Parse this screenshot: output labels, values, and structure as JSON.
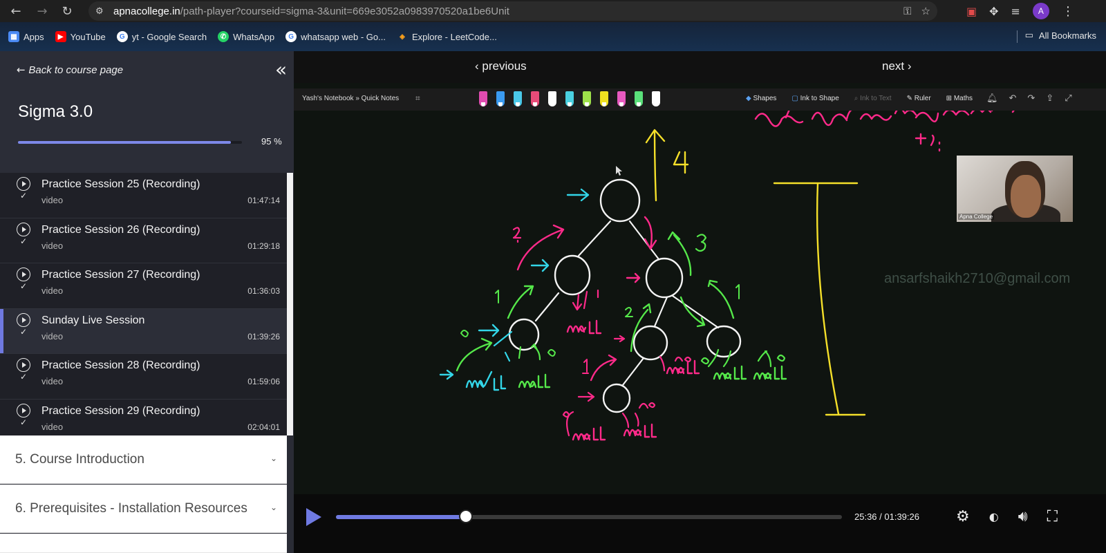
{
  "browser": {
    "url_domain": "apnacollege.in",
    "url_path": "/path-player?courseid=sigma-3&unit=669e3052a0983970520a1be6Unit",
    "profile_initial": "A",
    "bookmarks": [
      {
        "label": "Apps",
        "icon": "apps-grid-icon",
        "color": "#4a8af4"
      },
      {
        "label": "YouTube",
        "icon": "youtube-icon",
        "color": "#ff0000"
      },
      {
        "label": "yt - Google Search",
        "icon": "google-icon",
        "color": "#ffffff"
      },
      {
        "label": "WhatsApp",
        "icon": "whatsapp-icon",
        "color": "#25d366"
      },
      {
        "label": "whatsapp web - Go...",
        "icon": "google-icon",
        "color": "#ffffff"
      },
      {
        "label": "Explore - LeetCode...",
        "icon": "leetcode-icon",
        "color": "#f89f1b"
      }
    ],
    "all_bookmarks_label": "All Bookmarks"
  },
  "sidebar": {
    "back_label": "Back to course page",
    "course_title": "Sigma 3.0",
    "progress_percent": 95,
    "progress_label": "95 %",
    "lessons": [
      {
        "title": "Practice Session 25 (Recording)",
        "type": "video",
        "duration": "01:47:14",
        "active": false
      },
      {
        "title": "Practice Session 26 (Recording)",
        "type": "video",
        "duration": "01:29:18",
        "active": false
      },
      {
        "title": "Practice Session 27 (Recording)",
        "type": "video",
        "duration": "01:36:03",
        "active": false
      },
      {
        "title": "Sunday Live Session",
        "type": "video",
        "duration": "01:39:26",
        "active": true
      },
      {
        "title": "Practice Session 28 (Recording)",
        "type": "video",
        "duration": "01:59:06",
        "active": false
      },
      {
        "title": "Practice Session 29 (Recording)",
        "type": "video",
        "duration": "02:04:01",
        "active": false
      }
    ],
    "sections": [
      {
        "title": "5. Course Introduction"
      },
      {
        "title": "6. Prerequisites - Installation Resources"
      }
    ]
  },
  "player": {
    "previous_label": "previous",
    "next_label": "next",
    "notebook_title": "Yash's Notebook » Quick Notes",
    "toolbar": {
      "shapes": "Shapes",
      "ink_to_shape": "Ink to Shape",
      "ink_to_text": "Ink to Text",
      "ruler": "Ruler",
      "maths": "Maths"
    },
    "pen_colors": [
      "#e04bb0",
      "#3a9af0",
      "#4ac8e8",
      "#e84b78",
      "#ffffff",
      "#4ad0e0",
      "#9ee04a",
      "#f0e020",
      "#e85ac0",
      "#5ae07a",
      "#ffffff"
    ],
    "watermark": "ansarfshaikh2710@gmail.com",
    "webcam_label": "Apna College",
    "progress_fraction": 0.2573,
    "time_label": "25:36 / 01:39:26"
  }
}
